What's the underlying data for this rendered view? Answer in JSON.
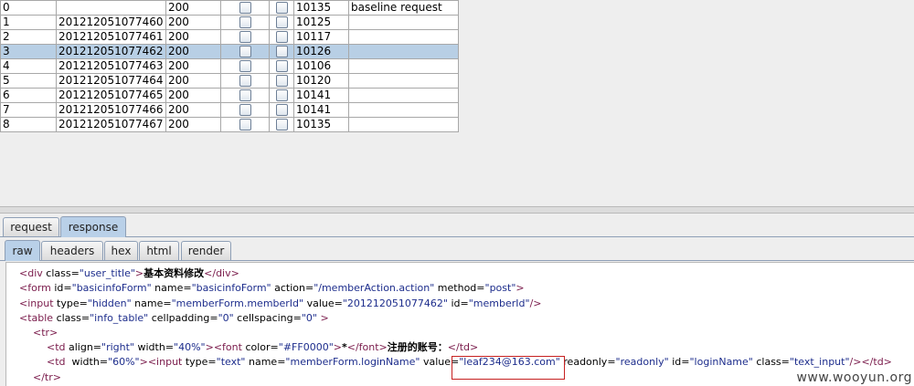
{
  "results": {
    "rows": [
      {
        "index": "0",
        "payload": "",
        "status": "200",
        "length": "10135",
        "comment": "baseline request"
      },
      {
        "index": "1",
        "payload": "201212051077460",
        "status": "200",
        "length": "10125",
        "comment": ""
      },
      {
        "index": "2",
        "payload": "201212051077461",
        "status": "200",
        "length": "10117",
        "comment": ""
      },
      {
        "index": "3",
        "payload": "201212051077462",
        "status": "200",
        "length": "10126",
        "comment": ""
      },
      {
        "index": "4",
        "payload": "201212051077463",
        "status": "200",
        "length": "10106",
        "comment": ""
      },
      {
        "index": "5",
        "payload": "201212051077464",
        "status": "200",
        "length": "10120",
        "comment": ""
      },
      {
        "index": "6",
        "payload": "201212051077465",
        "status": "200",
        "length": "10141",
        "comment": ""
      },
      {
        "index": "7",
        "payload": "201212051077466",
        "status": "200",
        "length": "10141",
        "comment": ""
      },
      {
        "index": "8",
        "payload": "201212051077467",
        "status": "200",
        "length": "10135",
        "comment": ""
      }
    ],
    "selected_index": 3
  },
  "tabs": {
    "main": [
      "request",
      "response"
    ],
    "main_active": 1,
    "sub": [
      "raw",
      "headers",
      "hex",
      "html",
      "render"
    ],
    "sub_active": 0
  },
  "code_lines": [
    [
      [
        "t",
        "<div "
      ],
      [
        "a",
        "class="
      ],
      [
        "v",
        "\"user_title\""
      ],
      [
        "t",
        ">"
      ],
      [
        "c",
        "基本资料修改"
      ],
      [
        "t",
        "</div>"
      ]
    ],
    [
      [
        "t",
        "<form "
      ],
      [
        "a",
        "id="
      ],
      [
        "v",
        "\"basicinfoForm\""
      ],
      [
        "a",
        " name="
      ],
      [
        "v",
        "\"basicinfoForm\""
      ],
      [
        "a",
        " action="
      ],
      [
        "v",
        "\"/memberAction.action\""
      ],
      [
        "a",
        " method="
      ],
      [
        "v",
        "\"post\""
      ],
      [
        "t",
        ">"
      ]
    ],
    [
      [
        "t",
        "<input "
      ],
      [
        "a",
        "type="
      ],
      [
        "v",
        "\"hidden\""
      ],
      [
        "a",
        " name="
      ],
      [
        "v",
        "\"memberForm.memberId\""
      ],
      [
        "a",
        " value="
      ],
      [
        "v",
        "\"201212051077462\""
      ],
      [
        "a",
        " id="
      ],
      [
        "v",
        "\"memberId\""
      ],
      [
        "t",
        "/>"
      ]
    ],
    [
      [
        "t",
        "<table "
      ],
      [
        "a",
        "class="
      ],
      [
        "v",
        "\"info_table\""
      ],
      [
        "a",
        " cellpadding="
      ],
      [
        "v",
        "\"0\""
      ],
      [
        "a",
        " cellspacing="
      ],
      [
        "v",
        "\"0\""
      ],
      [
        "t",
        " >"
      ]
    ],
    [
      [
        "t",
        "  <tr>"
      ]
    ],
    [
      [
        "t",
        "    <td "
      ],
      [
        "a",
        "align="
      ],
      [
        "v",
        "\"right\""
      ],
      [
        "a",
        " width="
      ],
      [
        "v",
        "\"40%\""
      ],
      [
        "t",
        ">"
      ],
      [
        "t",
        "<font "
      ],
      [
        "a",
        "color="
      ],
      [
        "v",
        "\"#FF0000\""
      ],
      [
        "t",
        ">"
      ],
      [
        "c",
        "*"
      ],
      [
        "t",
        "</font>"
      ],
      [
        "c",
        "注册的账号："
      ],
      [
        "t",
        "</td>"
      ]
    ],
    [
      [
        "t",
        "    <td  "
      ],
      [
        "a",
        "width="
      ],
      [
        "v",
        "\"60%\""
      ],
      [
        "t",
        ">"
      ],
      [
        "t",
        "<input "
      ],
      [
        "a",
        "type="
      ],
      [
        "v",
        "\"text\""
      ],
      [
        "a",
        " name="
      ],
      [
        "v",
        "\"memberForm.loginName\""
      ],
      [
        "a",
        " value="
      ],
      [
        "v",
        "\"leaf234@163.com\""
      ],
      [
        "a",
        " readonly="
      ],
      [
        "v",
        "\"readonly\""
      ],
      [
        "a",
        " id="
      ],
      [
        "v",
        "\"loginName\""
      ],
      [
        "a",
        " class="
      ],
      [
        "v",
        "\"text_input\""
      ],
      [
        "t",
        "/>"
      ],
      [
        "t",
        "</td>"
      ]
    ],
    [
      [
        "t",
        "  </tr>"
      ]
    ]
  ],
  "watermark": "www.wooyun.org"
}
